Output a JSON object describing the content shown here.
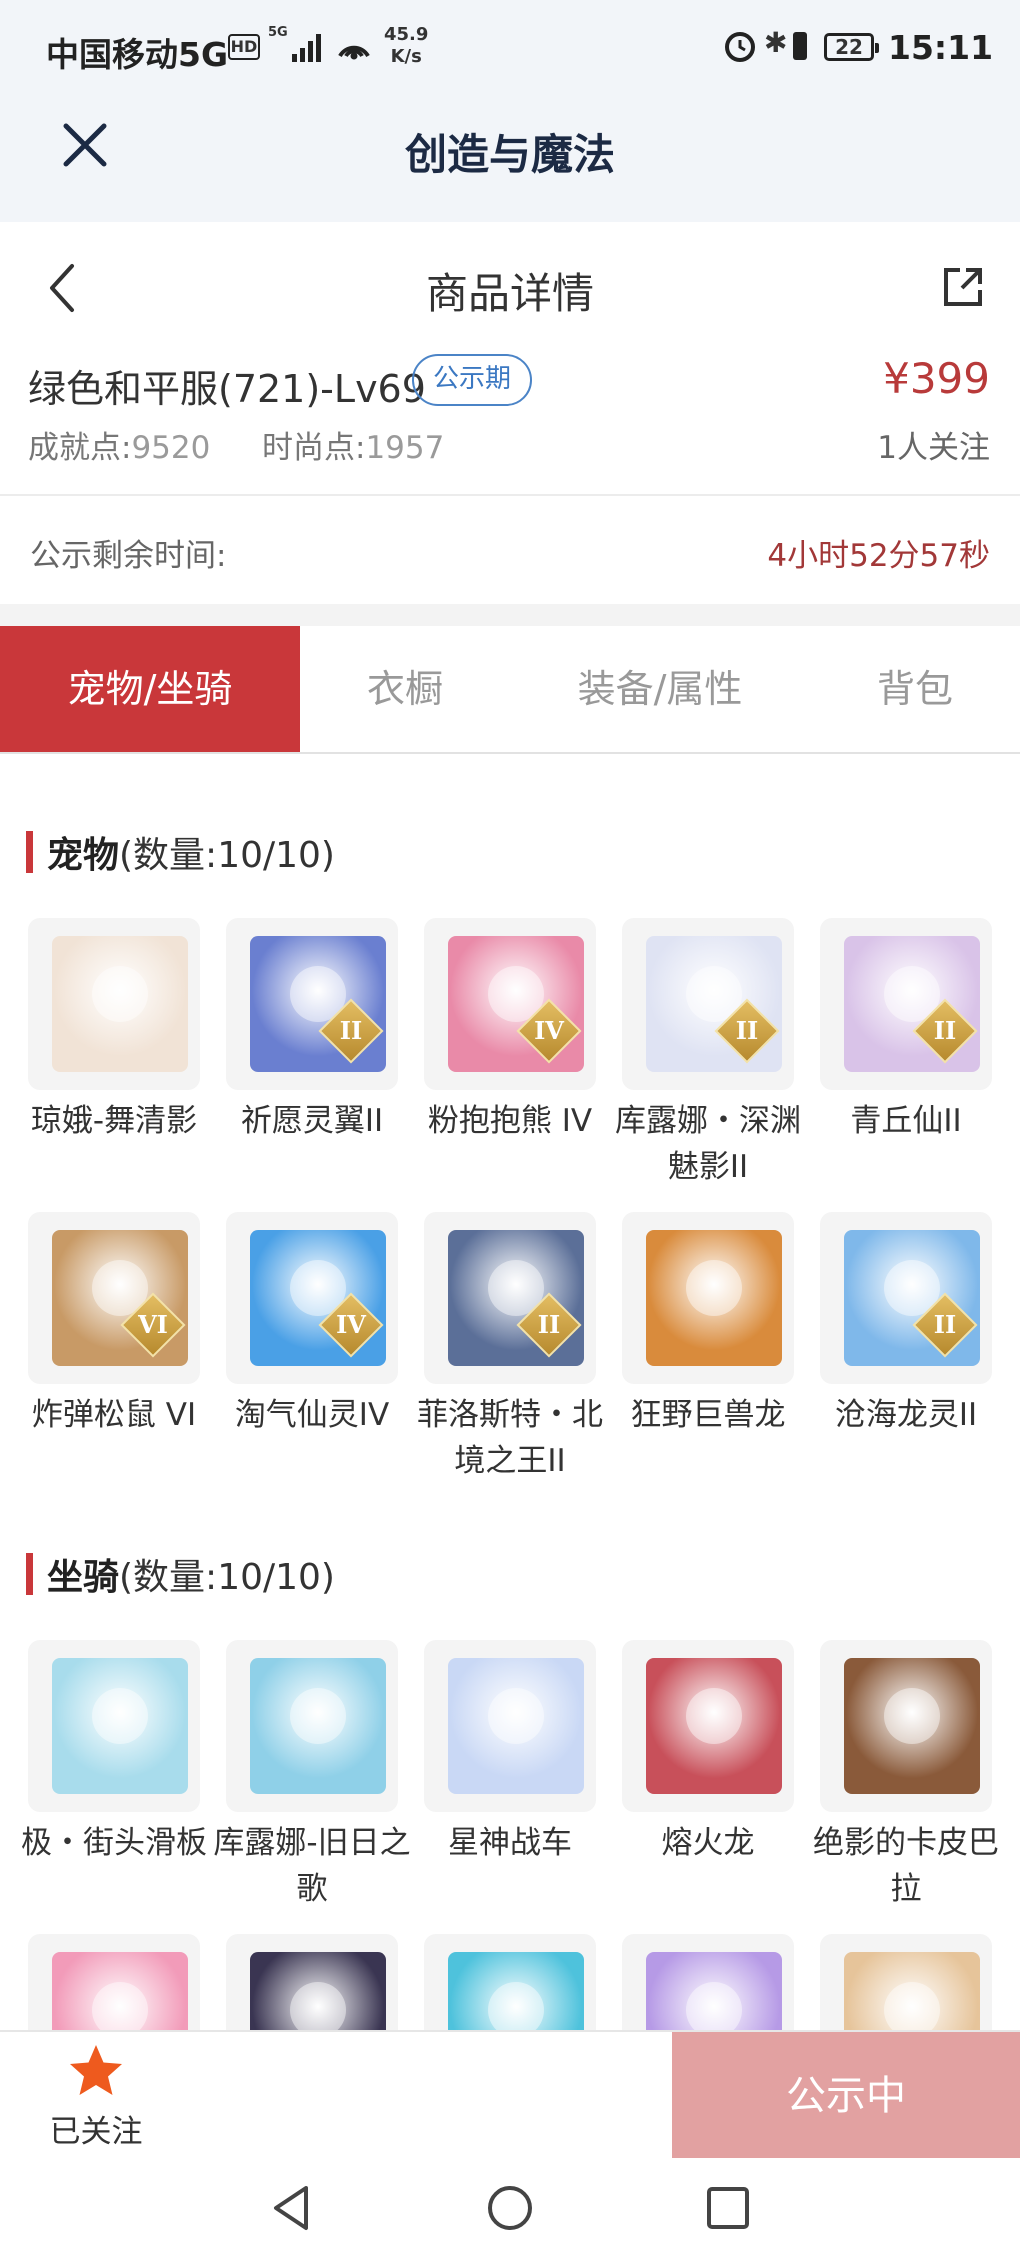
{
  "status_bar": {
    "carrier": "中国移动5G",
    "hd": "HD",
    "network": "5G",
    "speed_value": "45.9",
    "speed_unit": "K/s",
    "battery": "22",
    "time": "15:11"
  },
  "app": {
    "title": "创造与魔法"
  },
  "nav": {
    "title": "商品详情"
  },
  "product": {
    "name": "绿色和平服(721)-Lv69",
    "badge": "公示期",
    "price": "¥399",
    "achievement_label": "成就点:",
    "achievement_value": "9520",
    "fashion_label": "时尚点:",
    "fashion_value": "1957",
    "followers": "1人关注"
  },
  "timer": {
    "label": "公示剩余时间:",
    "value": "4小时52分57秒"
  },
  "tabs": [
    {
      "label": "宠物/坐骑",
      "active": true
    },
    {
      "label": "衣橱",
      "active": false
    },
    {
      "label": "装备/属性",
      "active": false
    },
    {
      "label": "背包",
      "active": false
    }
  ],
  "pets_section": {
    "title": "宠物",
    "count": "(数量:10/10)"
  },
  "pets": [
    {
      "name": "琼娥-舞清影",
      "tier": "",
      "icon": "maiden-pet",
      "color": "#f1e3d6"
    },
    {
      "name": "祈愿灵翼II",
      "tier": "II",
      "icon": "bird-pet",
      "color": "#6a7fd0"
    },
    {
      "name": "粉抱抱熊 IV",
      "tier": "IV",
      "icon": "bear-pet",
      "color": "#e98aa8"
    },
    {
      "name": "库露娜・深渊魅影II",
      "tier": "II",
      "icon": "ghost-maiden-pet",
      "color": "#dfe3f3"
    },
    {
      "name": "青丘仙II",
      "tier": "II",
      "icon": "fox-fairy-pet",
      "color": "#d9c3e8"
    },
    {
      "name": "炸弹松鼠 VI",
      "tier": "VI",
      "icon": "squirrel-pet",
      "color": "#c89a66"
    },
    {
      "name": "淘气仙灵IV",
      "tier": "IV",
      "icon": "blue-dog-pet",
      "color": "#4aa0e6"
    },
    {
      "name": "菲洛斯特・北境之王II",
      "tier": "II",
      "icon": "ice-king-pet",
      "color": "#5b6f98"
    },
    {
      "name": "狂野巨兽龙",
      "tier": "",
      "icon": "wild-dragon-pet",
      "color": "#d98b3c"
    },
    {
      "name": "沧海龙灵II",
      "tier": "II",
      "icon": "sea-dragon-spirit-pet",
      "color": "#7fb8ea"
    }
  ],
  "mounts_section": {
    "title": "坐骑",
    "count": "(数量:10/10)"
  },
  "mounts": [
    {
      "name": "极・街头滑板",
      "tier": "",
      "icon": "skateboard-mount",
      "color": "#a8dcec"
    },
    {
      "name": "库露娜-旧日之歌",
      "tier": "",
      "icon": "luna-song-mount",
      "color": "#8fd0e8"
    },
    {
      "name": "星神战车",
      "tier": "",
      "icon": "star-chariot-mount",
      "color": "#c9d8f5"
    },
    {
      "name": "熔火龙",
      "tier": "",
      "icon": "lava-dragon-mount",
      "color": "#c8505a"
    },
    {
      "name": "绝影的卡皮巴拉",
      "tier": "",
      "icon": "capybara-mount",
      "color": "#8a5a3a"
    },
    {
      "name": "",
      "tier": "",
      "icon": "pink-mount",
      "color": "#f29bb9"
    },
    {
      "name": "",
      "tier": "",
      "icon": "dark-dragon-mount",
      "color": "#3a3552"
    },
    {
      "name": "",
      "tier": "",
      "icon": "sea-dragon-mount",
      "color": "#4ec2dc"
    },
    {
      "name": "",
      "tier": "",
      "icon": "fish-mount",
      "color": "#b69ae6"
    },
    {
      "name": "",
      "tier": "",
      "icon": "antler-mount",
      "color": "#e6c49a"
    }
  ],
  "bottom": {
    "follow_label": "已关注",
    "cta_label": "公示中"
  },
  "colors": {
    "accent": "#c9373a",
    "price": "#b83a3a",
    "badge": "#4b84c7",
    "cta_disabled": "#e2a1a1"
  }
}
